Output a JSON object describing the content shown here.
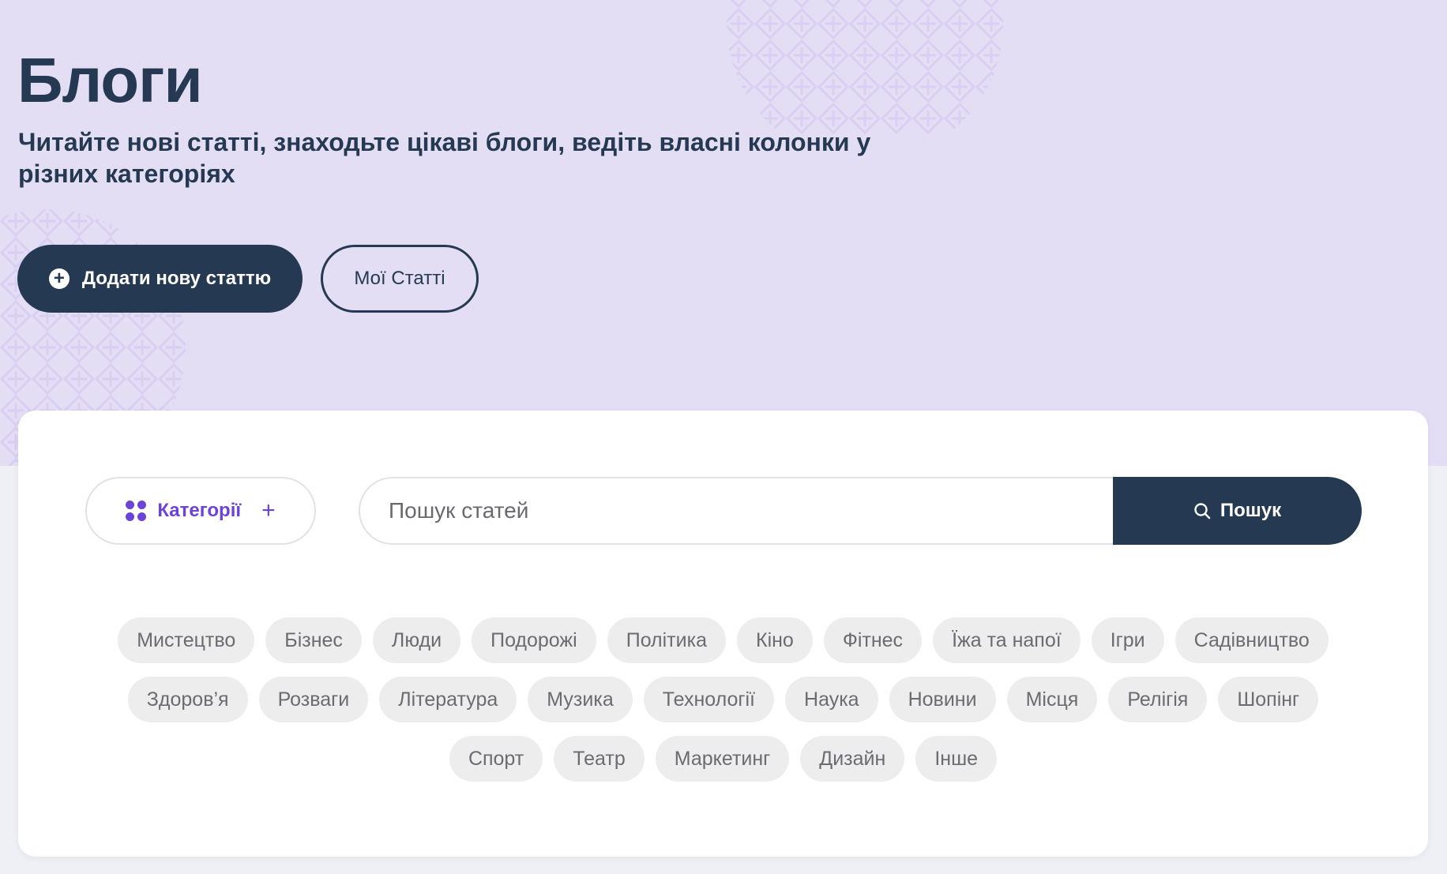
{
  "hero": {
    "title": "Блоги",
    "subtitle": "Читайте нові статті, знаходьте цікаві блоги, ведіть власні колонки у різних категоріях",
    "add_button_label": "Додати нову статтю",
    "add_button_icon": "plus-circle-icon",
    "my_articles_label": "Мої Статті"
  },
  "filters": {
    "categories_label": "Категорії",
    "categories_icon": "grid-dots-icon",
    "search_placeholder": "Пошук статей",
    "search_value": "",
    "search_button_label": "Пошук",
    "search_button_icon": "search-icon"
  },
  "tags": [
    [
      "Мистецтво",
      "Бізнес",
      "Люди",
      "Подорожі",
      "Політика",
      "Кіно",
      "Фітнес",
      "Їжа та напої",
      "Ігри",
      "Садівництво"
    ],
    [
      "Здоров’я",
      "Розваги",
      "Література",
      "Музика",
      "Технології",
      "Наука",
      "Новини",
      "Місця",
      "Релігія",
      "Шопінг"
    ],
    [
      "Спорт",
      "Театр",
      "Маркетинг",
      "Дизайн",
      "Інше"
    ]
  ],
  "colors": {
    "hero_bg": "#e4def5",
    "primary_dark": "#253a52",
    "accent_purple": "#6c43d9",
    "page_bg": "#eef0f5",
    "tag_bg": "#ededee"
  }
}
